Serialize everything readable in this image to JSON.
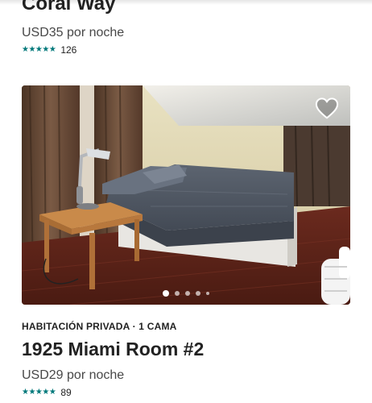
{
  "previous_listing": {
    "title": "Coral Way",
    "price": "USD35 por noche",
    "stars": "★★★★★",
    "review_count": "126"
  },
  "listing": {
    "type": "HABITACIÓN PRIVADA · 1 CAMA",
    "title": "1925 Miami Room #2",
    "price": "USD29 por noche",
    "stars": "★★★★★",
    "review_count": "89",
    "favorite_icon": "heart-outline-icon",
    "photo_count": 5,
    "active_photo_index": 0,
    "colors": {
      "star": "#00787a",
      "text": "#222222"
    }
  }
}
